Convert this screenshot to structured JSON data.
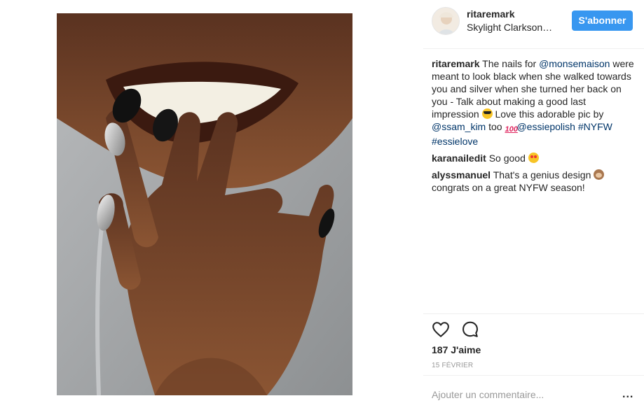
{
  "post": {
    "username": "ritaremark",
    "location": "Skylight Clarkson…",
    "follow_label": "S'abonner"
  },
  "comments": [
    {
      "user": "ritaremark",
      "parts": [
        {
          "text": " The nails for "
        },
        {
          "link": "@monsemaison"
        },
        {
          "text": " were meant to look black when she walked towards you and silver when she turned her back on you - Talk about making a good last impression "
        },
        {
          "emoji": "sunglasses-emoji"
        },
        {
          "text": " Love this adorable pic by "
        },
        {
          "link": "@ssam_kim"
        },
        {
          "text": " too "
        },
        {
          "emoji": "hundred-points-emoji"
        },
        {
          "link": "@essiepolish"
        },
        {
          "text": " "
        },
        {
          "link": "#NYFW"
        },
        {
          "text": " "
        },
        {
          "link": "#essielove"
        }
      ]
    },
    {
      "user": "karanailedit",
      "parts": [
        {
          "text": " So good "
        },
        {
          "emoji": "heart-eyes-emoji"
        }
      ]
    },
    {
      "user": "alyssmanuel",
      "parts": [
        {
          "text": " That's a genius design "
        },
        {
          "emoji": "see-no-evil-monkey-emoji"
        },
        {
          "text": " congrats on a great NYFW season!"
        }
      ]
    }
  ],
  "stats": {
    "likes": "187 J'aime",
    "date": "15 FÉVRIER"
  },
  "input": {
    "placeholder": "Ajouter un commentaire..."
  },
  "more_label": "...",
  "colors": {
    "accent": "#3897f0",
    "link": "#003569",
    "muted": "#999999"
  },
  "icons": [
    "heart-icon",
    "comment-icon",
    "more-options-icon"
  ]
}
